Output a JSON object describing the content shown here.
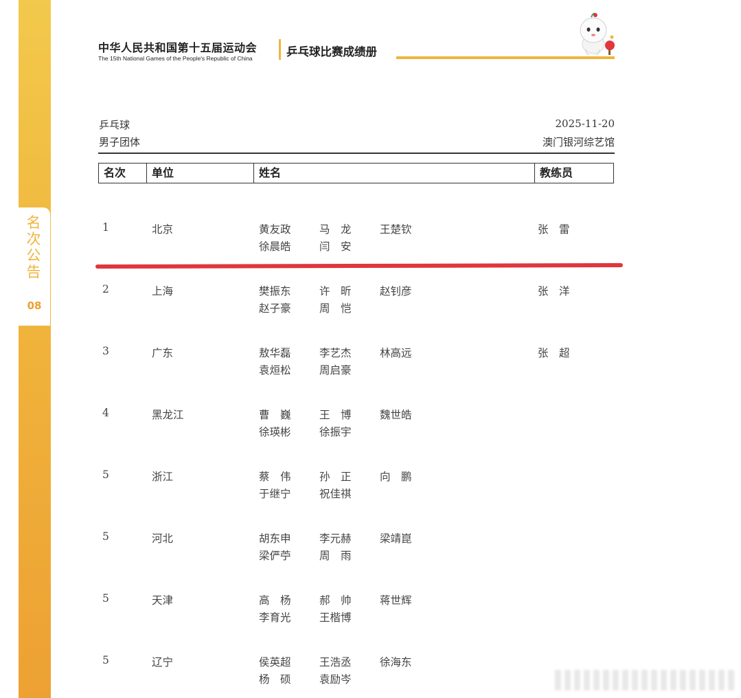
{
  "sidebar": {
    "label": "名次公告",
    "page": "08"
  },
  "header": {
    "title_cn": "中华人民共和国第十五届运动会",
    "title_en": "The 15th National Games of the People's Republic of China",
    "book": "乒乓球比赛成绩册"
  },
  "meta": {
    "sport": "乒乓球",
    "event": "男子团体",
    "date": "2025-11-20",
    "venue": "澳门银河综艺馆"
  },
  "table": {
    "headers": [
      "名次",
      "单位",
      "姓名",
      "教练员"
    ],
    "rows": [
      {
        "rank": "1",
        "unit": "北京",
        "names": [
          [
            "黄友政",
            "马　龙",
            "王楚钦"
          ],
          [
            "徐晨皓",
            "闫　安"
          ]
        ],
        "coach": "张　雷"
      },
      {
        "rank": "2",
        "unit": "上海",
        "names": [
          [
            "樊振东",
            "许　昕",
            "赵钊彦"
          ],
          [
            "赵子豪",
            "周　恺"
          ]
        ],
        "coach": "张　洋"
      },
      {
        "rank": "3",
        "unit": "广东",
        "names": [
          [
            "敖华磊",
            "李艺杰",
            "林高远"
          ],
          [
            "袁烜松",
            "周启豪"
          ]
        ],
        "coach": "张　超"
      },
      {
        "rank": "4",
        "unit": "黑龙江",
        "names": [
          [
            "曹　巍",
            "王　博",
            "魏世皓"
          ],
          [
            "徐瑛彬",
            "徐振宇"
          ]
        ],
        "coach": ""
      },
      {
        "rank": "5",
        "unit": "浙江",
        "names": [
          [
            "蔡　伟",
            "孙　正",
            "向　鹏"
          ],
          [
            "于继宁",
            "祝佳祺"
          ]
        ],
        "coach": ""
      },
      {
        "rank": "5",
        "unit": "河北",
        "names": [
          [
            "胡东申",
            "李元赫",
            "梁靖崑"
          ],
          [
            "梁俨苧",
            "周　雨"
          ]
        ],
        "coach": ""
      },
      {
        "rank": "5",
        "unit": "天津",
        "names": [
          [
            "高　杨",
            "郝　帅",
            "蒋世辉"
          ],
          [
            "李育光",
            "王楷博"
          ]
        ],
        "coach": ""
      },
      {
        "rank": "5",
        "unit": "辽宁",
        "names": [
          [
            "侯英超",
            "王浩丞",
            "徐海东"
          ],
          [
            "杨　硕",
            "袁励岑"
          ]
        ],
        "coach": ""
      }
    ]
  },
  "colors": {
    "accent": "#f0b43c",
    "highlight_line": "#e0363c"
  }
}
